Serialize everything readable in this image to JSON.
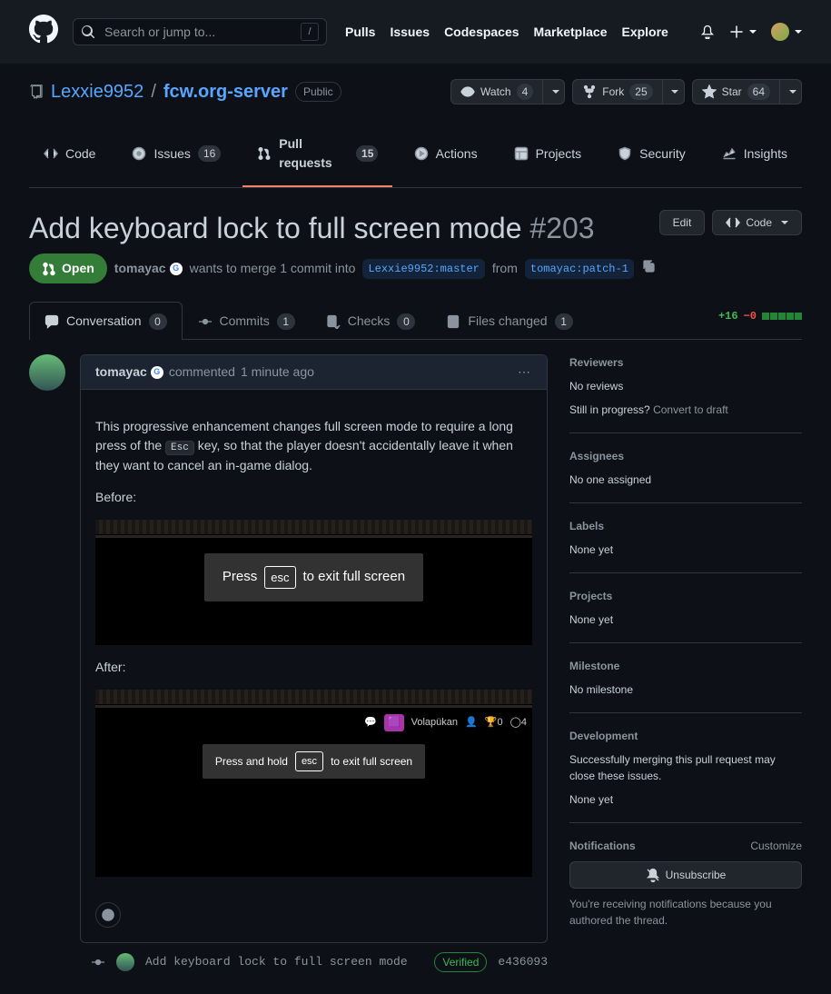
{
  "nav": {
    "search_placeholder": "Search or jump to...",
    "slash": "/",
    "links": [
      "Pulls",
      "Issues",
      "Codespaces",
      "Marketplace",
      "Explore"
    ]
  },
  "repo": {
    "owner": "Lexxie9952",
    "name": "fcw.org-server",
    "badge": "Public",
    "watch_label": "Watch",
    "watch_count": "4",
    "fork_label": "Fork",
    "fork_count": "25",
    "star_label": "Star",
    "star_count": "64"
  },
  "repo_nav": {
    "code": "Code",
    "issues": "Issues",
    "issues_count": "16",
    "pulls": "Pull requests",
    "pulls_count": "15",
    "actions": "Actions",
    "projects": "Projects",
    "security": "Security",
    "insights": "Insights"
  },
  "pr": {
    "title": "Add keyboard lock to full screen mode",
    "number": "#203",
    "edit": "Edit",
    "code_btn": "Code",
    "state": "Open",
    "author": "tomayac",
    "merge_text_a": "wants to merge 1 commit into",
    "base": "Lexxie9952:master",
    "merge_text_b": "from",
    "head": "tomayac:patch-1"
  },
  "pr_tabs": {
    "conversation": "Conversation",
    "conversation_count": "0",
    "commits": "Commits",
    "commits_count": "1",
    "checks": "Checks",
    "checks_count": "0",
    "files": "Files changed",
    "files_count": "1",
    "additions": "+16",
    "deletions": "−0"
  },
  "comment": {
    "author": "tomayac",
    "commented": "commented",
    "time": "1 minute ago",
    "body_prefix": "This progressive enhancement changes full screen mode to require a long press of the ",
    "esc_key": "Esc",
    "body_suffix": " key, so that the player doesn't accidentally leave it when they want to cancel an in-game dialog.",
    "before_label": "Before:",
    "after_label": "After:",
    "toast_before_a": "Press",
    "toast_before_key": "esc",
    "toast_before_b": "to exit full screen",
    "toast_after_a": "Press and hold",
    "toast_after_key": "esc",
    "toast_after_b": "to exit full screen",
    "after_player": "Volapükan",
    "after_stat1": "0",
    "after_stat2": "4"
  },
  "commit_line": {
    "msg": "Add keyboard lock to full screen mode",
    "verified": "Verified",
    "sha": "e436093"
  },
  "side": {
    "reviewers_h": "Reviewers",
    "reviewers_v": "No reviews",
    "draft_q": "Still in progress?",
    "draft_link": "Convert to draft",
    "assignees_h": "Assignees",
    "assignees_v": "No one assigned",
    "labels_h": "Labels",
    "labels_v": "None yet",
    "projects_h": "Projects",
    "projects_v": "None yet",
    "milestone_h": "Milestone",
    "milestone_v": "No milestone",
    "dev_h": "Development",
    "dev_v1": "Successfully merging this pull request may close these issues.",
    "dev_v2": "None yet",
    "notif_h": "Notifications",
    "customize": "Customize",
    "unsubscribe": "Unsubscribe",
    "notif_desc": "You're receiving notifications because you authored the thread."
  }
}
